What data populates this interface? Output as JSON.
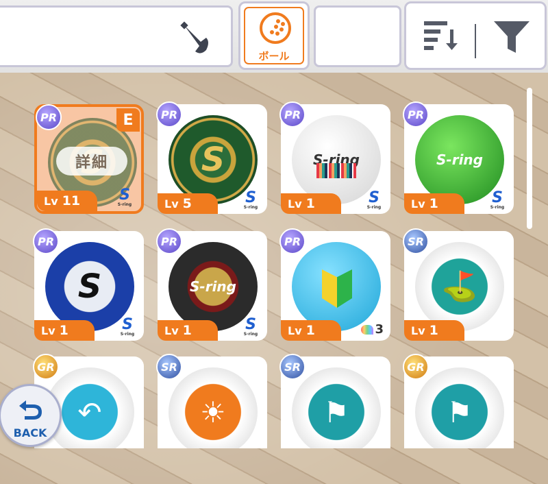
{
  "colors": {
    "accent": "#f07b1e",
    "card_bg": "#ffffff",
    "selected_bg": "#f8c6a4",
    "back_blue": "#1e5fae"
  },
  "header": {
    "club_tab_icon": "golf-club-icon",
    "ball_tab": {
      "label": "ボール",
      "icon": "golf-ball-icon"
    },
    "sort_icon": "sort-icon",
    "filter_icon": "filter-icon"
  },
  "balls": [
    {
      "rarity": "PR",
      "level_prefix": "Lv",
      "level": "11",
      "brand": "S",
      "brand_sub": "S-ring",
      "selected": true,
      "badge": "E",
      "detail_label": "詳細",
      "design": "sring-green-gold"
    },
    {
      "rarity": "PR",
      "level_prefix": "Lv",
      "level": "5",
      "brand": "S",
      "brand_sub": "S-ring",
      "design": "sring-green-gold"
    },
    {
      "rarity": "PR",
      "level_prefix": "Lv",
      "level": "1",
      "brand": "S",
      "brand_sub": "S-ring",
      "design": "sring-white-bars"
    },
    {
      "rarity": "PR",
      "level_prefix": "Lv",
      "level": "1",
      "brand": "S",
      "brand_sub": "S-ring",
      "design": "sring-lime"
    },
    {
      "rarity": "PR",
      "level_prefix": "Lv",
      "level": "1",
      "brand": "S",
      "brand_sub": "S-ring",
      "design": "sring-blue"
    },
    {
      "rarity": "PR",
      "level_prefix": "Lv",
      "level": "1",
      "brand": "S",
      "brand_sub": "S-ring",
      "design": "sring-black-gold"
    },
    {
      "rarity": "PR",
      "level_prefix": "Lv",
      "level": "1",
      "evolution_count": "3",
      "design": "beginner-mark-cyan"
    },
    {
      "rarity": "SR",
      "level_prefix": "Lv",
      "level": "1",
      "design": "white-ball-in-cup"
    },
    {
      "rarity": "GR",
      "design": "white-curve-shot"
    },
    {
      "rarity": "SR",
      "design": "white-sun"
    },
    {
      "rarity": "SR",
      "design": "white-weathervane"
    },
    {
      "rarity": "GR",
      "design": "white-weathervane"
    }
  ],
  "back_button": {
    "label": "BACK",
    "icon": "back-arrow-icon"
  }
}
